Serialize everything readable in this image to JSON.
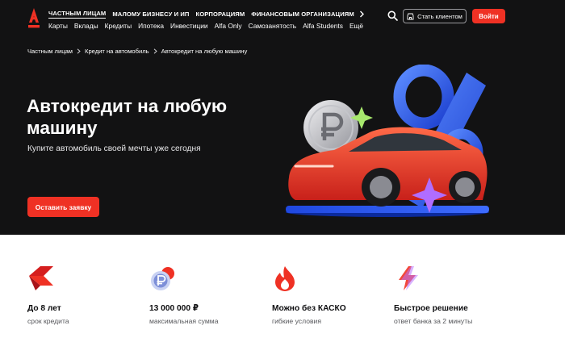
{
  "header": {
    "segments": [
      {
        "label": "ЧАСТНЫМ ЛИЦАМ",
        "active": true
      },
      {
        "label": "МАЛОМУ БИЗНЕСУ И ИП",
        "active": false
      },
      {
        "label": "КОРПОРАЦИЯМ",
        "active": false
      },
      {
        "label": "ФИНАНСОВЫМ ОРГАНИЗАЦИЯМ",
        "active": false
      }
    ],
    "products": [
      "Карты",
      "Вклады",
      "Кредиты",
      "Ипотека",
      "Инвестиции",
      "Alfa Only",
      "Самозанятость",
      "Alfa Students",
      "Ещё"
    ],
    "become_client_label": "Стать клиентом",
    "login_label": "Войти"
  },
  "breadcrumb": {
    "items": [
      "Частным лицам",
      "Кредит на автомобиль"
    ],
    "current": "Автокредит на любую машину"
  },
  "hero": {
    "title": "Автокредит на любую машину",
    "subtitle": "Купите автомобиль своей мечты уже сегодня",
    "cta_label": "Оставить заявку"
  },
  "features": [
    {
      "icon": "arrow-bend-icon",
      "title": "До 8 лет",
      "subtitle": "срок кредита"
    },
    {
      "icon": "coins-icon",
      "title": "13 000 000 ₽",
      "subtitle": "максимальная сумма"
    },
    {
      "icon": "flame-icon",
      "title": "Можно без КАСКО",
      "subtitle": "гибкие условия"
    },
    {
      "icon": "lightning-icon",
      "title": "Быстрое решение",
      "subtitle": "ответ банка за 2 минуты"
    }
  ],
  "colors": {
    "brand_red": "#ef3124",
    "dark_bg": "#121213",
    "percent_blue": "#2f5ff0"
  }
}
